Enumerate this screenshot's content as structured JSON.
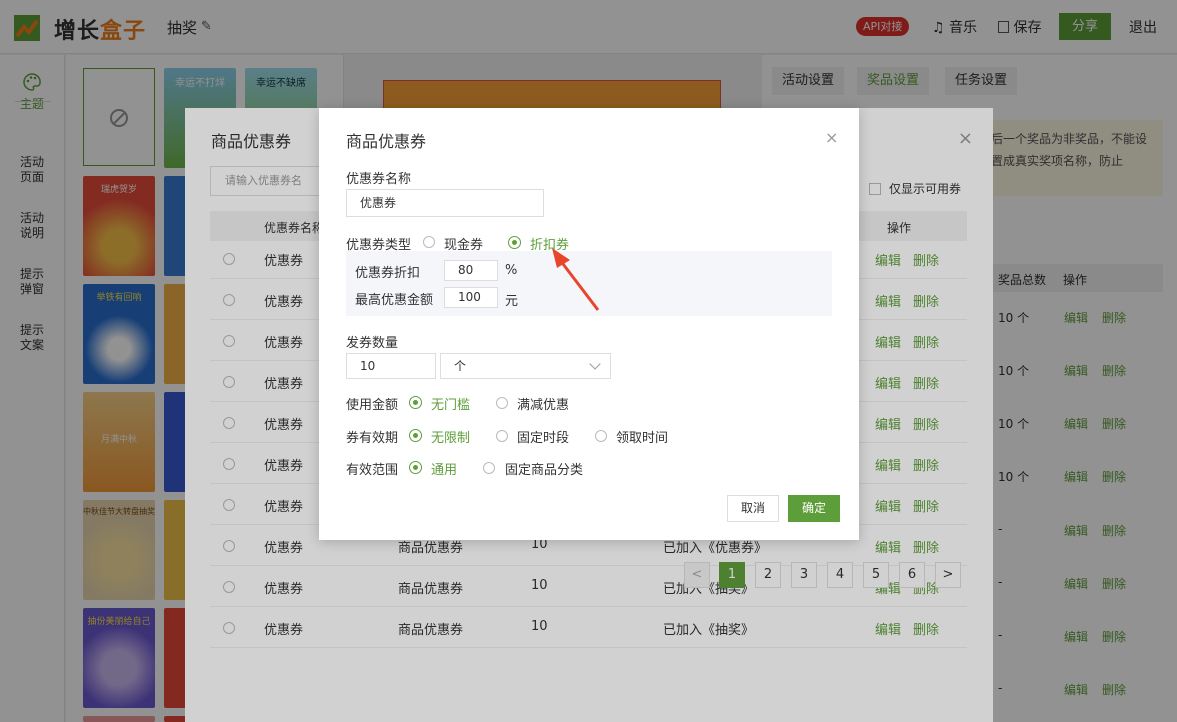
{
  "header": {
    "logo_text_1": "增长",
    "logo_text_2": "盒子",
    "page_title": "抽奖",
    "api_badge": "API对接",
    "music": "音乐",
    "save": "保存",
    "share": "分享",
    "exit": "退出"
  },
  "leftnav": {
    "items": [
      {
        "label": "主题"
      },
      {
        "label": "活动\n页面"
      },
      {
        "label": "活动\n说明"
      },
      {
        "label": "提示\n弹窗"
      },
      {
        "label": "提示\n文案"
      }
    ]
  },
  "thumbnails": {
    "titles": [
      "幸运不打烊",
      "幸运不缺席",
      "瑞虎贺岁",
      "举铁有回响",
      "月满中秋",
      "中秋佳节大转盘抽奖",
      "抽份美丽给自己"
    ]
  },
  "settings": {
    "tabs": [
      "活动设置",
      "奖品设置",
      "任务设置"
    ],
    "notice": "后一个奖品为非奖品，不能设置成真实奖项名称，防止",
    "prize_table_headers": [
      "奖品总数",
      "操作"
    ],
    "prize_rows": [
      {
        "total": "10 个",
        "edit": "编辑",
        "delete": "删除"
      },
      {
        "total": "10 个",
        "edit": "编辑",
        "delete": "删除"
      },
      {
        "total": "10 个",
        "edit": "编辑",
        "delete": "删除"
      },
      {
        "total": "10 个",
        "edit": "编辑",
        "delete": "删除"
      },
      {
        "total": "-",
        "edit": "编辑",
        "delete": "删除"
      },
      {
        "total": "-",
        "edit": "编辑",
        "delete": "删除"
      },
      {
        "total": "-",
        "edit": "编辑",
        "delete": "删除"
      },
      {
        "total": "-",
        "edit": "编辑",
        "delete": "删除"
      }
    ]
  },
  "bg_dialog": {
    "title": "商品优惠券",
    "search_placeholder": "请输入优惠券名",
    "only_available": "仅显示可用券",
    "headers": [
      "优惠券名称",
      "操作"
    ],
    "rows": [
      {
        "name": "优惠券",
        "type": "",
        "count": "",
        "status": "",
        "edit": "编辑",
        "delete": "删除"
      },
      {
        "name": "优惠券",
        "type": "",
        "count": "",
        "status": "",
        "edit": "编辑",
        "delete": "删除"
      },
      {
        "name": "优惠券",
        "type": "",
        "count": "",
        "status": "",
        "edit": "编辑",
        "delete": "删除"
      },
      {
        "name": "优惠券",
        "type": "",
        "count": "",
        "status": "",
        "edit": "编辑",
        "delete": "删除"
      },
      {
        "name": "优惠券",
        "type": "",
        "count": "",
        "status": "",
        "edit": "编辑",
        "delete": "删除"
      },
      {
        "name": "优惠券",
        "type": "",
        "count": "",
        "status": "",
        "edit": "编辑",
        "delete": "删除"
      },
      {
        "name": "优惠券",
        "type": "",
        "count": "",
        "status": "",
        "edit": "编辑",
        "delete": "删除"
      },
      {
        "name": "优惠券",
        "type": "商品优惠券",
        "count": "10",
        "status": "已加入《优惠券》",
        "edit": "编辑",
        "delete": "删除"
      },
      {
        "name": "优惠券",
        "type": "商品优惠券",
        "count": "10",
        "status": "已加入《抽奖》",
        "edit": "编辑",
        "delete": "删除"
      },
      {
        "name": "优惠券",
        "type": "商品优惠券",
        "count": "10",
        "status": "已加入《抽奖》",
        "edit": "编辑",
        "delete": "删除"
      }
    ],
    "pages": [
      "1",
      "2",
      "3",
      "4",
      "5",
      "6"
    ],
    "prev": "<",
    "next": ">"
  },
  "modal": {
    "title": "商品优惠券",
    "close": "×",
    "name_label": "优惠券名称",
    "name_value": "优惠券",
    "type_label": "优惠券类型",
    "type_cash": "现金券",
    "type_discount": "折扣券",
    "discount_label": "优惠券折扣",
    "discount_value": "80",
    "discount_unit": "%",
    "max_label": "最高优惠金额",
    "max_value": "100",
    "max_unit": "元",
    "qty_label": "发券数量",
    "qty_value": "10",
    "qty_unit": "个",
    "use_label": "使用金额",
    "use_opt1": "无门槛",
    "use_opt2": "满减优惠",
    "valid_label": "券有效期",
    "valid_opt1": "无限制",
    "valid_opt2": "固定时段",
    "valid_opt3": "领取时间",
    "scope_label": "有效范围",
    "scope_opt1": "通用",
    "scope_opt2": "固定商品分类",
    "cancel": "取消",
    "ok": "确定"
  },
  "colors": {
    "accent": "#5e9e3a",
    "brand_orange": "#f07d1a",
    "api_red": "#e0312d",
    "annotation_arrow": "#e8452c"
  }
}
